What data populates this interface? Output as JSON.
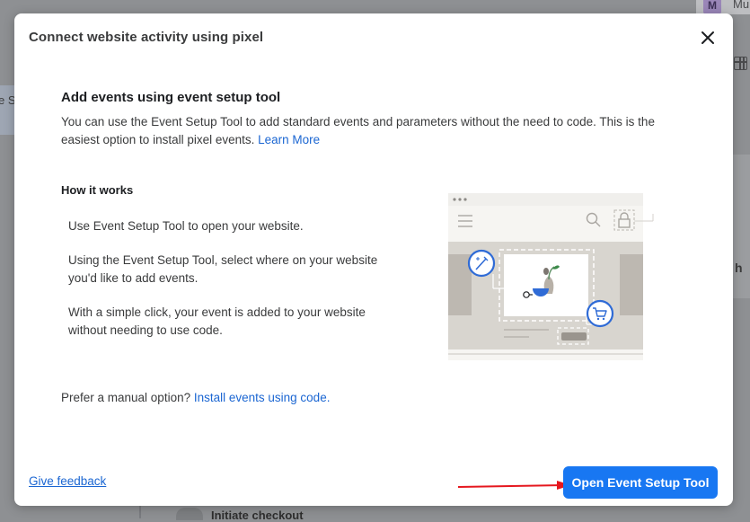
{
  "background": {
    "avatar_letter": "M",
    "user_text": "Mu",
    "right_heading_fragment": "h",
    "left_fragment": "e S",
    "bottom_item": "Initiate checkout"
  },
  "modal": {
    "title": "Connect website activity using pixel",
    "section_title": "Add events using event setup tool",
    "description": "You can use the Event Setup Tool to add standard events and parameters without the need to code. This is the easiest option to install pixel events.",
    "learn_more": "Learn More",
    "how_it_works": "How it works",
    "steps": [
      "Use Event Setup Tool to open your website.",
      "Using the Event Setup Tool, select where on your website you'd like to add events.",
      "With a simple click, your event is added to your website without needing to use code."
    ],
    "manual_prefix": "Prefer a manual option?",
    "manual_link": "Install events using code.",
    "feedback_link": "Give feedback",
    "primary_button": "Open Event Setup Tool"
  },
  "colors": {
    "accent": "#1877f2",
    "link": "#1b66d2",
    "annotation_arrow": "#e5171e"
  },
  "icons": [
    "close-icon",
    "magic-wand-icon",
    "cart-icon",
    "search-icon",
    "lock-icon",
    "hamburger-menu-icon"
  ]
}
